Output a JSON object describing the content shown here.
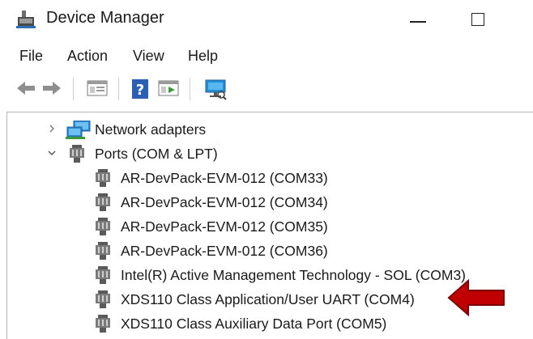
{
  "window": {
    "title": "Device Manager"
  },
  "menu": {
    "items": [
      "File",
      "Action",
      "View",
      "Help"
    ]
  },
  "toolbar": {
    "buttons": [
      "back-arrow-icon",
      "forward-arrow-icon",
      "properties-icon",
      "help-icon",
      "update-driver-icon",
      "scan-hardware-icon"
    ]
  },
  "tree": {
    "network_adapters": "Network adapters",
    "ports": "Ports (COM & LPT)",
    "devices": [
      "AR-DevPack-EVM-012 (COM33)",
      "AR-DevPack-EVM-012 (COM34)",
      "AR-DevPack-EVM-012 (COM35)",
      "AR-DevPack-EVM-012 (COM36)",
      "Intel(R) Active Management Technology - SOL (COM3)",
      "XDS110 Class Application/User UART (COM4)",
      "XDS110 Class Auxiliary Data Port (COM5)"
    ]
  },
  "colors": {
    "arrow": "#c00000",
    "arrow_outline": "#7a0000"
  }
}
